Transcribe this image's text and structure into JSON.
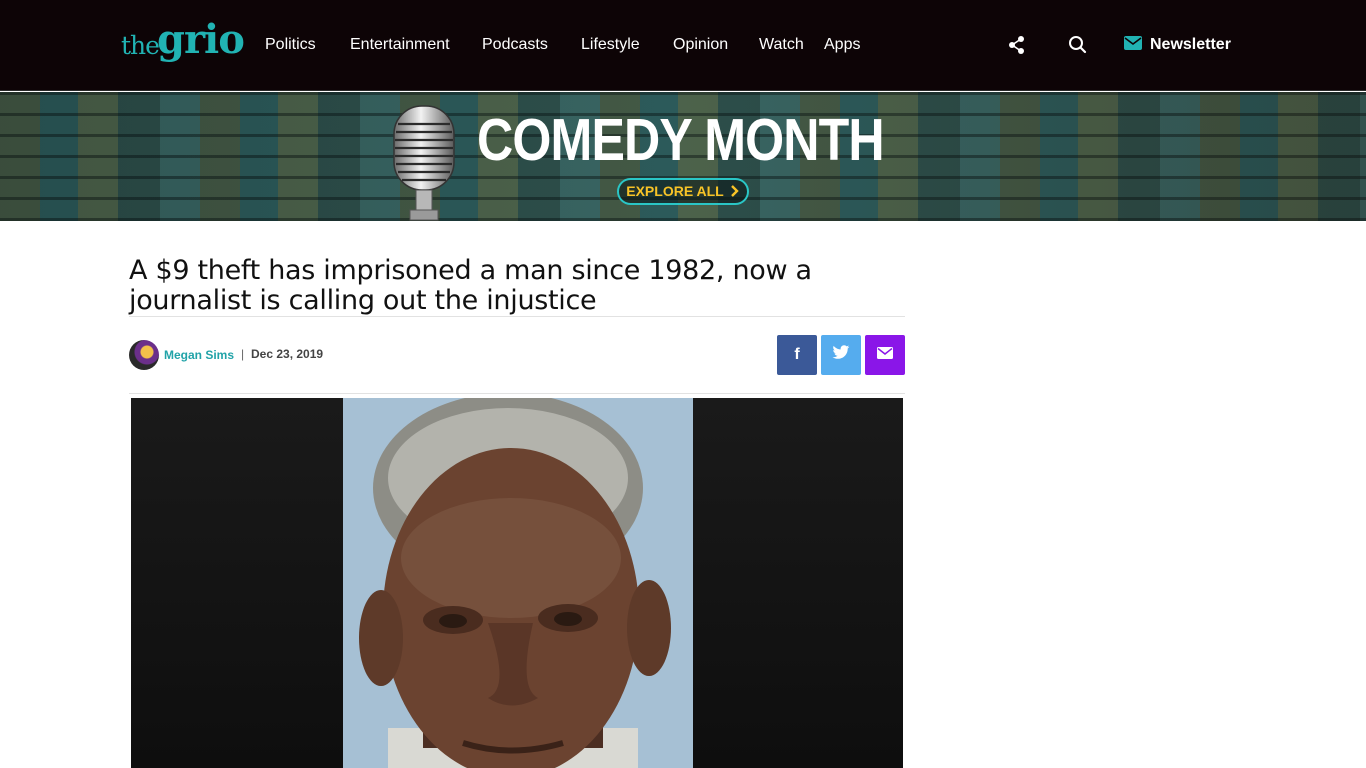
{
  "header": {
    "logo": {
      "the": "the",
      "grio": "grio"
    },
    "nav": [
      "Politics",
      "Entertainment",
      "Podcasts",
      "Lifestyle",
      "Opinion",
      "Watch",
      "Apps"
    ],
    "newsletter_label": "Newsletter",
    "icons": [
      "share-icon",
      "search-icon",
      "mail-icon"
    ],
    "colors": {
      "background": "#0d0406",
      "brand": "#21b3b3"
    }
  },
  "banner": {
    "title": "COMEDY MONTH",
    "cta": "EXPLORE ALL",
    "colors": {
      "cta_text": "#f7c327",
      "cta_border": "#2ac6c6"
    }
  },
  "article": {
    "headline": "A $9 theft has imprisoned a man since 1982, now a journalist is calling out the injustice",
    "author": "Megan Sims",
    "separator": "|",
    "date": "Dec 23, 2019",
    "share": {
      "facebook": "f",
      "icons": [
        "facebook-icon",
        "twitter-icon",
        "email-icon"
      ]
    },
    "colors": {
      "author": "#21a3a8",
      "facebook": "#3b5998",
      "twitter": "#55acee",
      "email": "#8a16e8"
    }
  }
}
